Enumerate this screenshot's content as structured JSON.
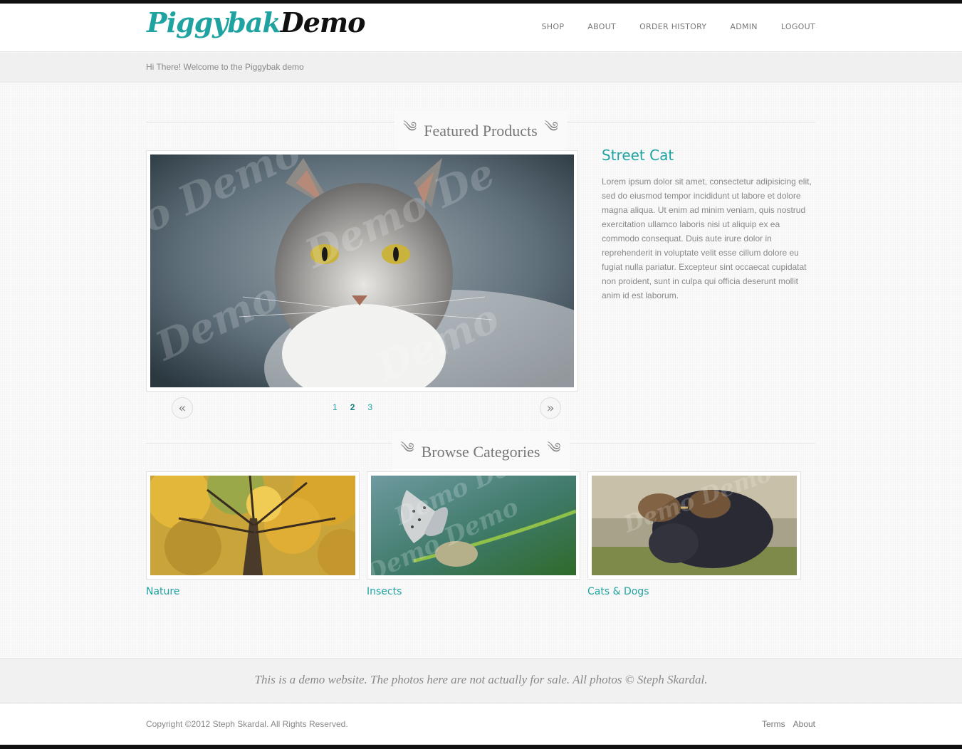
{
  "brand": {
    "logo_part1": "Piggybak",
    "logo_part2": "Demo",
    "accent_color": "#1fa3a1"
  },
  "nav": {
    "items": [
      "SHOP",
      "ABOUT",
      "ORDER HISTORY",
      "ADMIN",
      "LOGOUT"
    ]
  },
  "welcome": "Hi There! Welcome to the Piggybak demo",
  "featured": {
    "heading": "Featured Products",
    "product_title": "Street Cat",
    "product_description": "Lorem ipsum dolor sit amet, consectetur adipisicing elit, sed do eiusmod tempor incididunt ut labore et dolore magna aliqua. Ut enim ad minim veniam, quis nostrud exercitation ullamco laboris nisi ut aliquip ex ea commodo consequat. Duis aute irure dolor in reprehenderit in voluptate velit esse cillum dolore eu fugiat nulla pariatur. Excepteur sint occaecat cupidatat non proident, sunt in culpa qui officia deserunt mollit anim id est laborum.",
    "prev_glyph": "«",
    "next_glyph": "»",
    "pages": [
      "1",
      "2",
      "3"
    ],
    "active_page": "2"
  },
  "categories": {
    "heading": "Browse Categories",
    "items": [
      {
        "label": "Nature"
      },
      {
        "label": "Insects"
      },
      {
        "label": "Cats & Dogs"
      }
    ]
  },
  "disclaimer": "This is a demo website. The photos here are not actually for sale. All photos © Steph Skardal.",
  "footer": {
    "copyright": "Copyright ©2012 Steph Skardal. All Rights Reserved.",
    "links": [
      "Terms",
      "About"
    ]
  }
}
